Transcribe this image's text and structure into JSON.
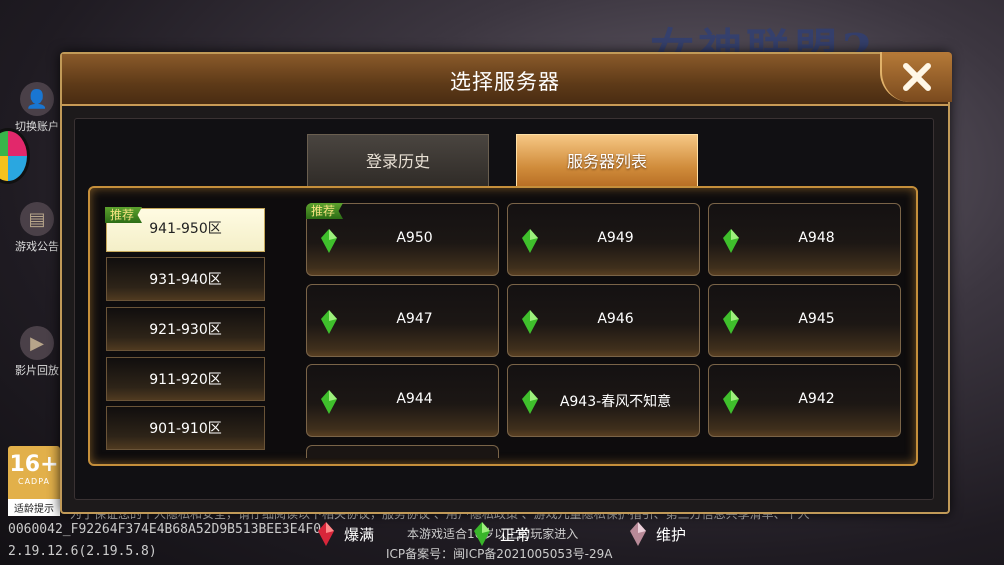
{
  "background": {
    "logo_text": "女神联盟2",
    "left_icons": [
      {
        "label": "切换账户",
        "icon": "account-icon"
      },
      {
        "label": "游戏公告",
        "icon": "notice-icon"
      },
      {
        "label": "影片回放",
        "icon": "video-icon"
      }
    ],
    "age_badge": {
      "number": "16+",
      "caption": "CADPA",
      "label": "适龄提示"
    },
    "scroll_text": "为了保证您的个人隐私和安全，请仔细阅读以下相关协议，服务协议 、用户隐私政策 、游戏儿童隐私保护指引、第三方信息共享清单、个人",
    "device_id": "0060042_F92264F374E4B68A52D9B513BEE3E4F0",
    "version": "2.19.12.6(2.19.5.8)",
    "age_notice": "本游戏适合16岁以上的玩家进入",
    "icp": "ICP备案号：闽ICP备2021005053号-29A"
  },
  "dialog": {
    "title": "选择服务器",
    "tabs": [
      {
        "label": "登录历史",
        "active": false
      },
      {
        "label": "服务器列表",
        "active": true
      }
    ],
    "recommend_tag": "推荐",
    "zones": [
      {
        "label": "941-950区",
        "selected": true
      },
      {
        "label": "931-940区",
        "selected": false
      },
      {
        "label": "921-930区",
        "selected": false
      },
      {
        "label": "911-920区",
        "selected": false
      },
      {
        "label": "901-910区",
        "selected": false
      }
    ],
    "servers": [
      {
        "name": "A950",
        "status": "normal"
      },
      {
        "name": "A949",
        "status": "normal"
      },
      {
        "name": "A948",
        "status": "normal"
      },
      {
        "name": "A947",
        "status": "normal"
      },
      {
        "name": "A946",
        "status": "normal"
      },
      {
        "name": "A945",
        "status": "normal"
      },
      {
        "name": "A944",
        "status": "normal"
      },
      {
        "name": "A943-春风不知意",
        "status": "normal"
      },
      {
        "name": "A942",
        "status": "normal"
      }
    ],
    "legend": [
      {
        "label": "爆满",
        "color": "#d8263a"
      },
      {
        "label": "正常",
        "color": "#39b52a"
      },
      {
        "label": "维护",
        "color": "#c79aa8"
      }
    ]
  }
}
